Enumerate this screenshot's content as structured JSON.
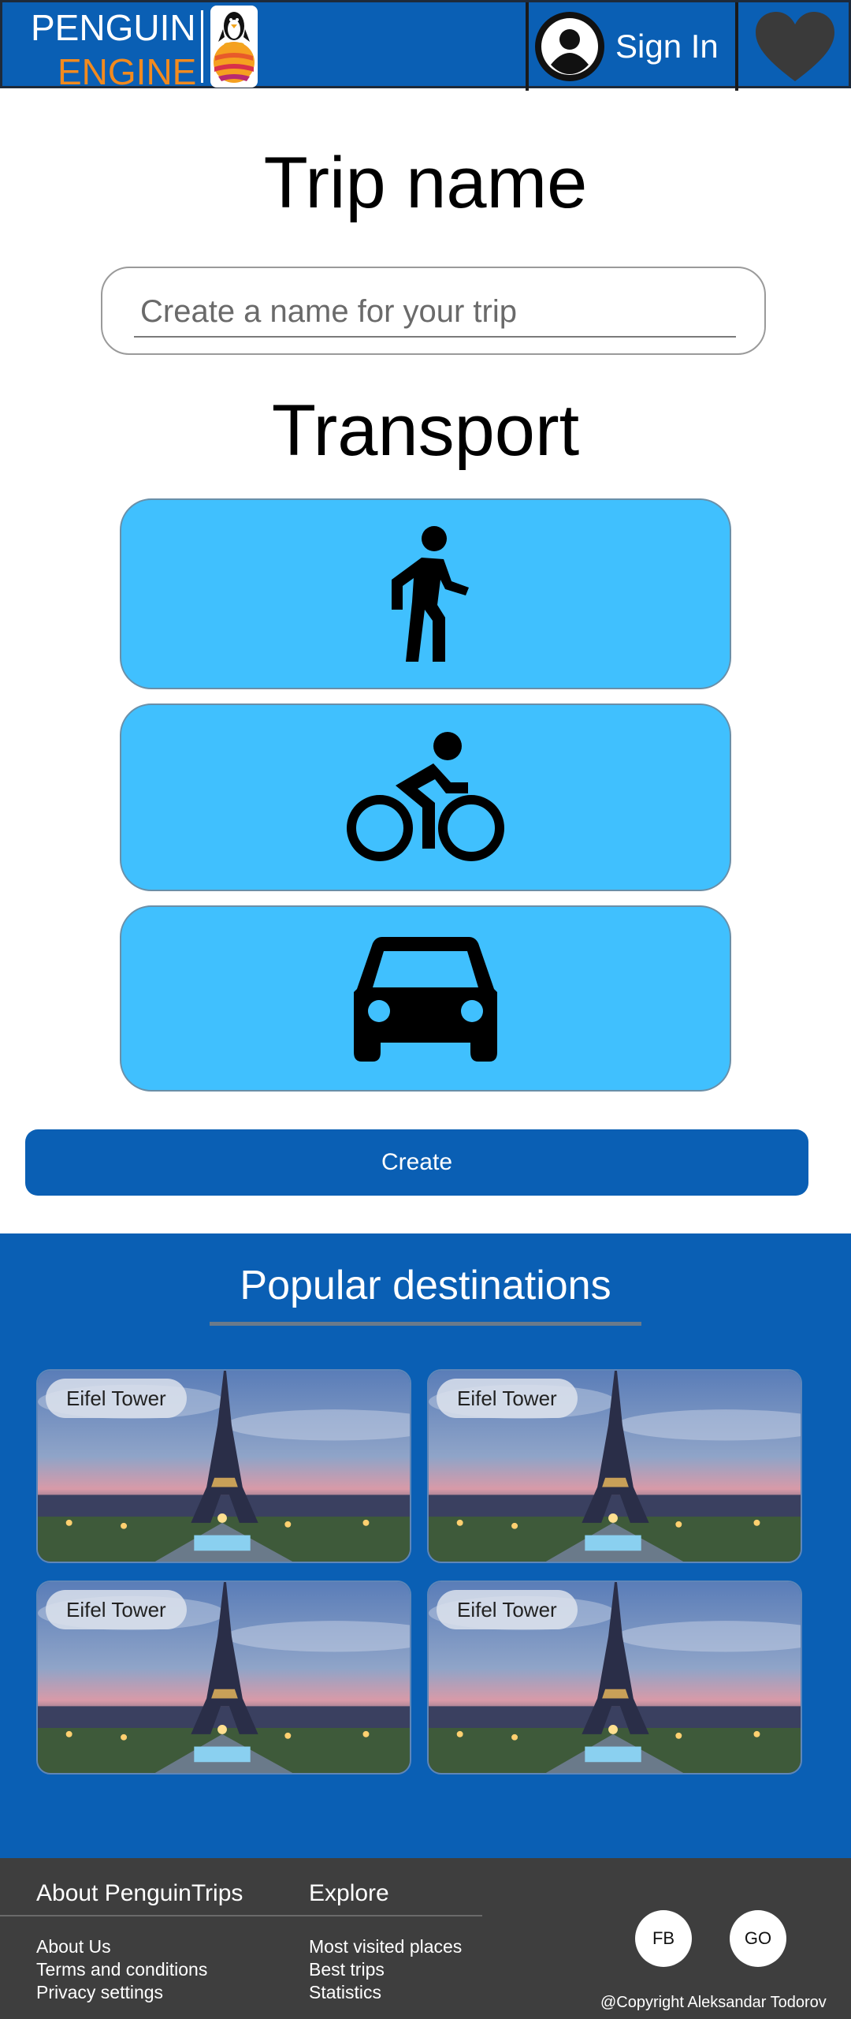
{
  "header": {
    "logo_line1": "PENGUIN",
    "logo_line2": "ENGINE",
    "sign_in_label": "Sign In",
    "icons": [
      "penguin-logo-icon",
      "user-avatar-icon",
      "heart-icon"
    ],
    "colors": {
      "brand_blue": "#0a5fb4",
      "logo_accent": "#f28a1e"
    }
  },
  "trip": {
    "title": "Trip name",
    "name_placeholder": "Create a name for your trip",
    "name_value": ""
  },
  "transport": {
    "title": "Transport",
    "options": [
      {
        "icon": "walking-icon"
      },
      {
        "icon": "bicycle-icon"
      },
      {
        "icon": "car-icon"
      }
    ],
    "button_color": "#40c0fe"
  },
  "create_label": "Create",
  "popular": {
    "title": "Popular destinations",
    "cards": [
      {
        "label": "Eifel Tower"
      },
      {
        "label": "Eifel Tower"
      },
      {
        "label": "Eifel Tower"
      },
      {
        "label": "Eifel Tower"
      }
    ]
  },
  "footer": {
    "about_heading": "About PenguinTrips",
    "about_links": [
      "About Us",
      "Terms and conditions",
      "Privacy settings"
    ],
    "explore_heading": "Explore",
    "explore_links": [
      "Most visited places",
      "Best trips",
      "Statistics"
    ],
    "social": [
      "FB",
      "GO"
    ],
    "copyright": "@Copyright Aleksandar Todorov"
  }
}
